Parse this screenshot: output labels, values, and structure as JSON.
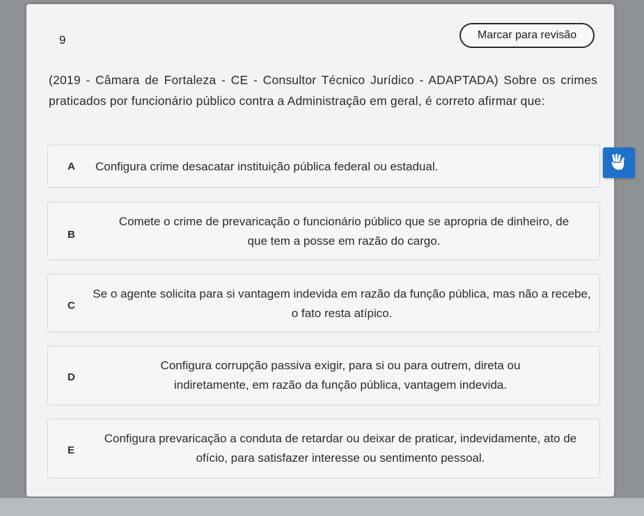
{
  "question": {
    "number": "9",
    "review_label": "Marcar para revisão",
    "statement": "(2019 - Câmara de Fortaleza - CE - Consultor Técnico Jurídico - ADAPTADA) Sobre os crimes praticados por funcionário público contra a Administração em geral, é correto afirmar que:"
  },
  "options": [
    {
      "letter": "A",
      "text": "Configura crime desacatar instituição pública federal ou estadual."
    },
    {
      "letter": "B",
      "text": "Comete o crime de prevaricação o funcionário público que se apropria de dinheiro, de que tem a posse em razão do cargo."
    },
    {
      "letter": "C",
      "text": "Se o agente solicita para si vantagem indevida em razão da função pública, mas não a recebe, o fato resta atípico."
    },
    {
      "letter": "D",
      "text": "Configura corrupção passiva exigir, para si ou para outrem, direta ou indiretamente, em razão da função pública, vantagem indevida."
    },
    {
      "letter": "E",
      "text": "Configura prevaricação a conduta de retardar ou deixar de praticar, indevidamente, ato de ofício, para satisfazer interesse ou sentimento pessoal."
    }
  ],
  "accessibility": {
    "icon": "sign-language-hands-icon",
    "color": "#1e70c9"
  }
}
